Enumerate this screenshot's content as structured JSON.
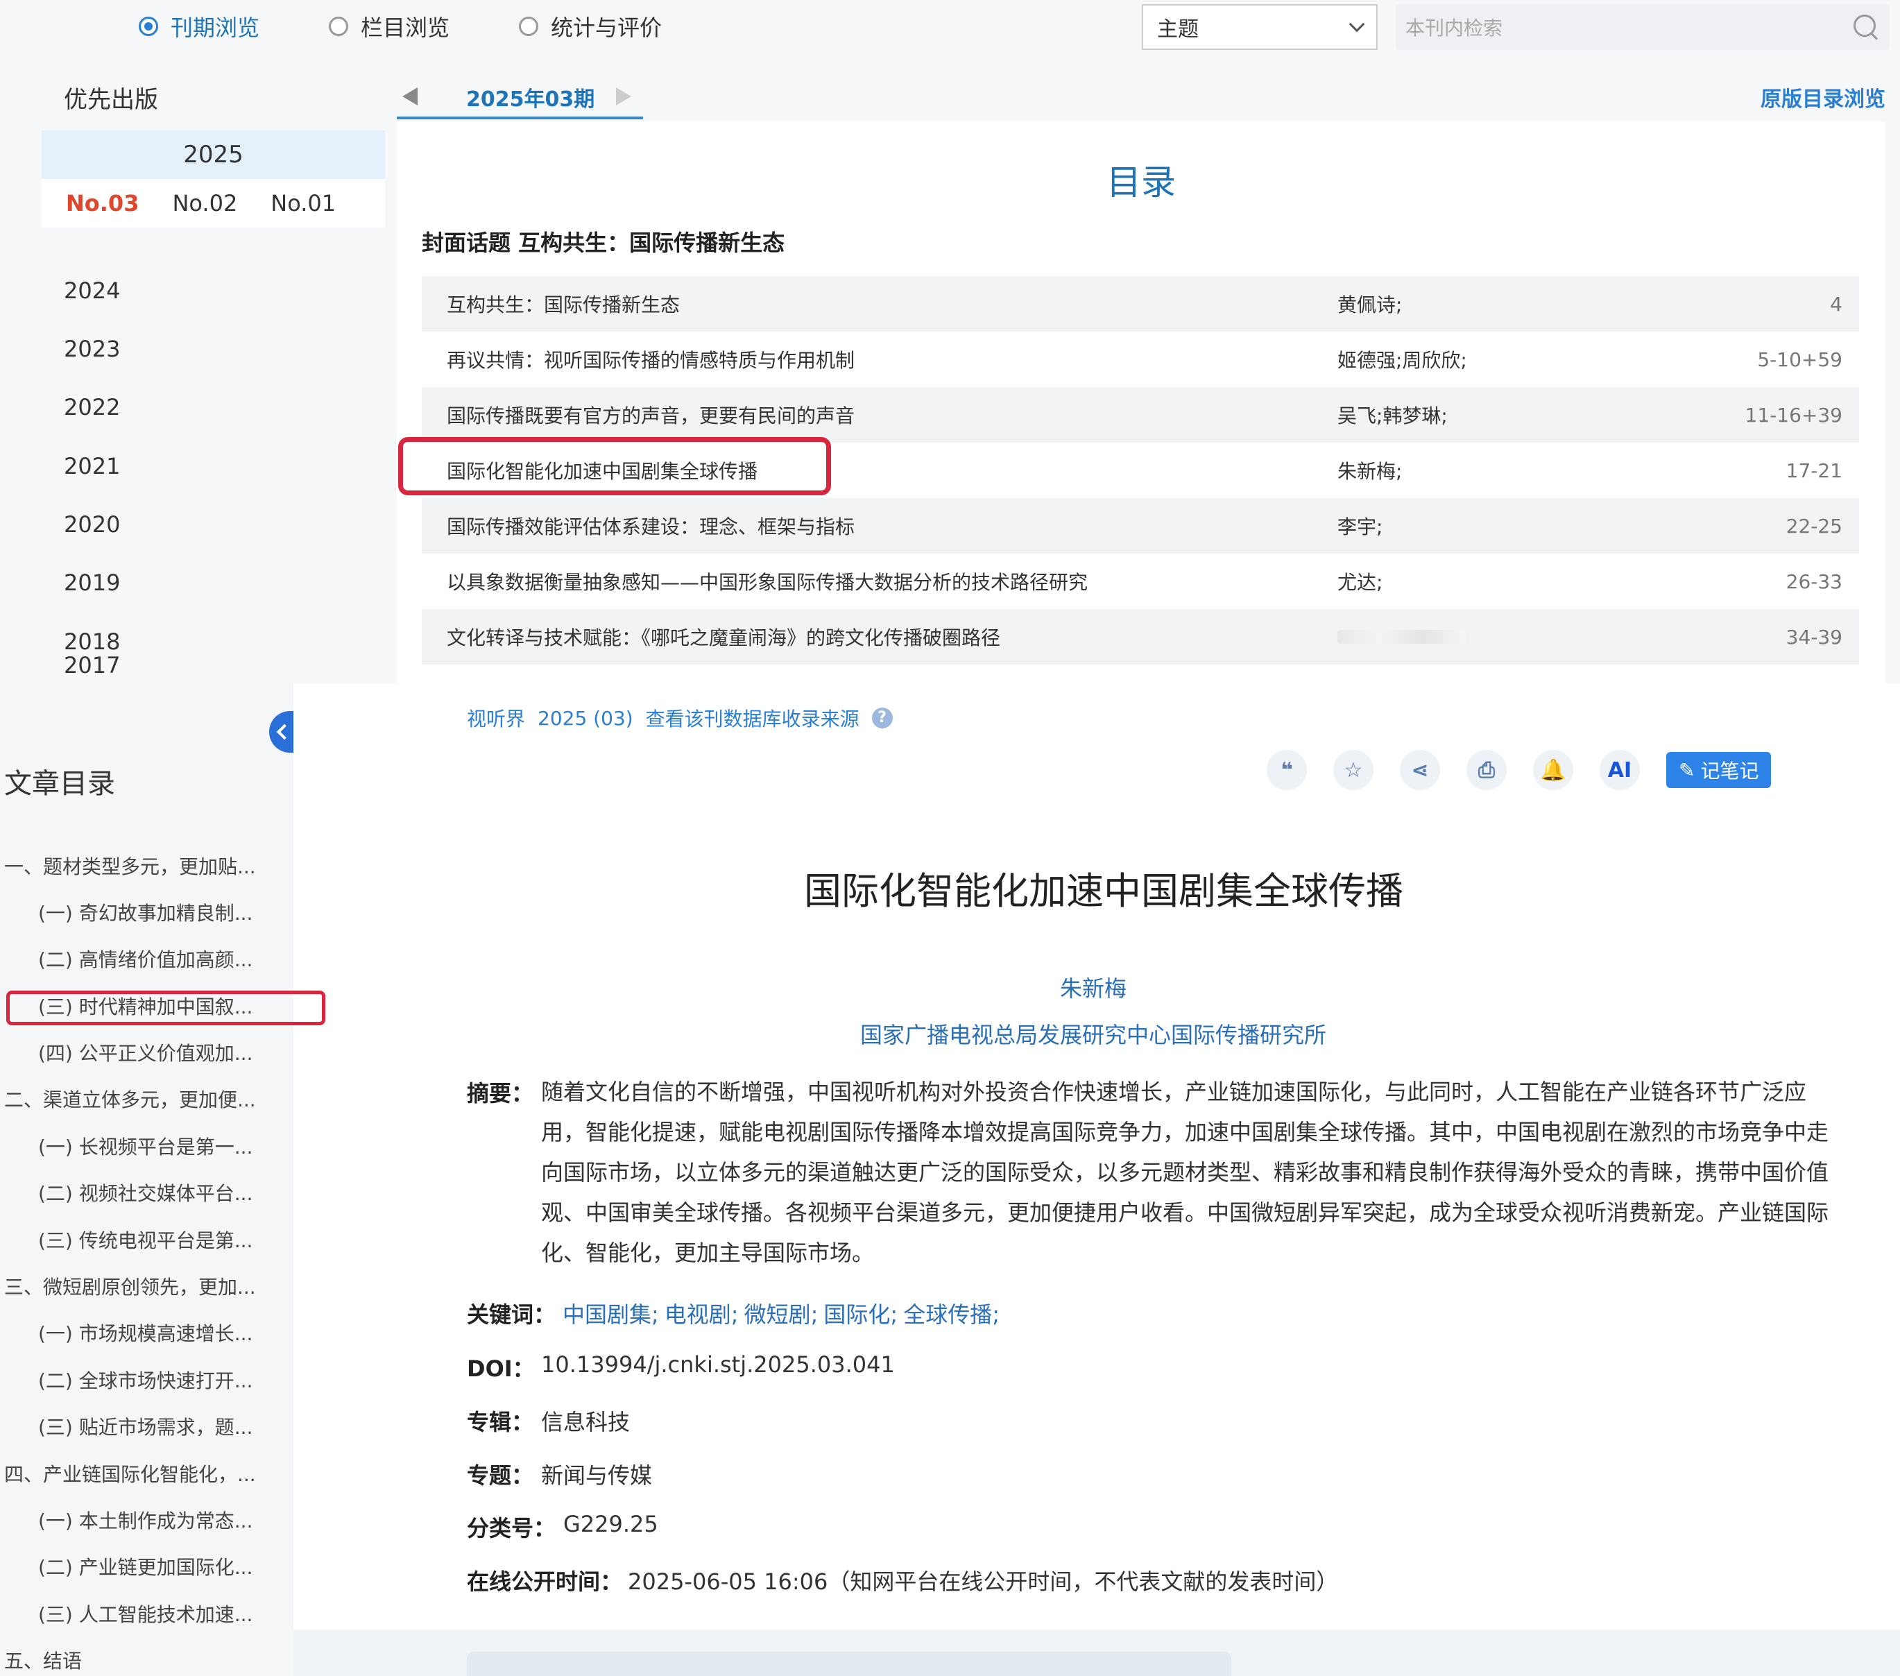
{
  "top": {
    "radios": [
      {
        "label": "刊期浏览",
        "selected": true
      },
      {
        "label": "栏目浏览",
        "selected": false
      },
      {
        "label": "统计与评价",
        "selected": false
      }
    ],
    "search_scope": "主题",
    "search_placeholder": "本刊内检索",
    "priority_label": "优先出版",
    "current_year": "2025",
    "issues": [
      "No.03",
      "No.02",
      "No.01"
    ],
    "years": [
      "2024",
      "2023",
      "2022",
      "2021",
      "2020",
      "2019",
      "2018",
      "2017"
    ],
    "current_issue_tab": "2025年03期",
    "orig_toc_link": "原版目录浏览",
    "toc_title": "目录",
    "section_heading": "封面话题 互构共生：国际传播新生态",
    "toc_rows": [
      {
        "title": "互构共生：国际传播新生态",
        "author": "黄佩诗;",
        "pages": "4"
      },
      {
        "title": "再议共情：视听国际传播的情感特质与作用机制",
        "author": "姬德强;周欣欣;",
        "pages": "5-10+59"
      },
      {
        "title": "国际传播既要有官方的声音，更要有民间的声音",
        "author": "吴飞;韩梦琳;",
        "pages": "11-16+39"
      },
      {
        "title": "国际化智能化加速中国剧集全球传播",
        "author": "朱新梅;",
        "pages": "17-21"
      },
      {
        "title": "国际传播效能评估体系建设：理念、框架与指标",
        "author": "李宇;",
        "pages": "22-25"
      },
      {
        "title": "以具象数据衡量抽象感知——中国形象国际传播大数据分析的技术路径研究",
        "author": "尤达;",
        "pages": "26-33"
      },
      {
        "title": "文化转译与技术赋能：《哪吒之魔童闹海》的跨文化传播破圈路径",
        "author": "",
        "pages": "34-39"
      }
    ]
  },
  "nav": {
    "title": "文章目录",
    "items": [
      "一、题材类型多元，更加贴...",
      "(一) 奇幻故事加精良制...",
      "(二) 高情绪价值加高颜...",
      "(三) 时代精神加中国叙...",
      "(四) 公平正义价值观加...",
      "二、渠道立体多元，更加便...",
      "(一) 长视频平台是第一...",
      "(二) 视频社交媒体平台...",
      "(三) 传统电视平台是第...",
      "三、微短剧原创领先，更加...",
      "(一) 市场规模高速增长...",
      "(二) 全球市场快速打开...",
      "(三) 贴近市场需求，题...",
      "四、产业链国际化智能化，...",
      "(一) 本土制作成为常态...",
      "(二) 产业链更加国际化...",
      "(三) 人工智能技术加速...",
      "五、结语"
    ]
  },
  "article": {
    "journal": "视听界",
    "issue": "2025 (03)",
    "source_link": "查看该刊数据库收录来源",
    "help_icon": "?",
    "tools": [
      {
        "icon": "quote-icon",
        "glyph": "❝"
      },
      {
        "icon": "star-icon",
        "glyph": "☆"
      },
      {
        "icon": "share-icon",
        "glyph": "⋖"
      },
      {
        "icon": "print-icon",
        "glyph": "⎙"
      },
      {
        "icon": "bell-icon",
        "glyph": "🔔"
      },
      {
        "icon": "ai-icon",
        "glyph": "AI"
      }
    ],
    "note_label": "记笔记",
    "title": "国际化智能化加速中国剧集全球传播",
    "author": "朱新梅",
    "institution": "国家广播电视总局发展研究中心国际传播研究所",
    "abstract_label": "摘要：",
    "abstract": "随着文化自信的不断增强，中国视听机构对外投资合作快速增长，产业链加速国际化，与此同时，人工智能在产业链各环节广泛应用，智能化提速，赋能电视剧国际传播降本增效提高国际竞争力，加速中国剧集全球传播。其中，中国电视剧在激烈的市场竞争中走向国际市场，以立体多元的渠道触达更广泛的国际受众，以多元题材类型、精彩故事和精良制作获得海外受众的青睐，携带中国价值观、中国审美全球传播。各视频平台渠道多元，更加便捷用户收看。中国微短剧异军突起，成为全球受众视听消费新宠。产业链国际化、智能化，更加主导国际市场。",
    "keywords_label": "关键词：",
    "keywords": [
      "中国剧集;",
      "电视剧;",
      "微短剧;",
      "国际化;",
      "全球传播;"
    ],
    "doi_label": "DOI：",
    "doi": "10.13994/j.cnki.stj.2025.03.041",
    "album_label": "专辑：",
    "album": "信息科技",
    "topic_label": "专题：",
    "topic": "新闻与传媒",
    "class_label": "分类号：",
    "class_no": "G229.25",
    "online_label": "在线公开时间：",
    "online_time": "2025-06-05 16:06（知网平台在线公开时间，不代表文献的发表时间）"
  }
}
